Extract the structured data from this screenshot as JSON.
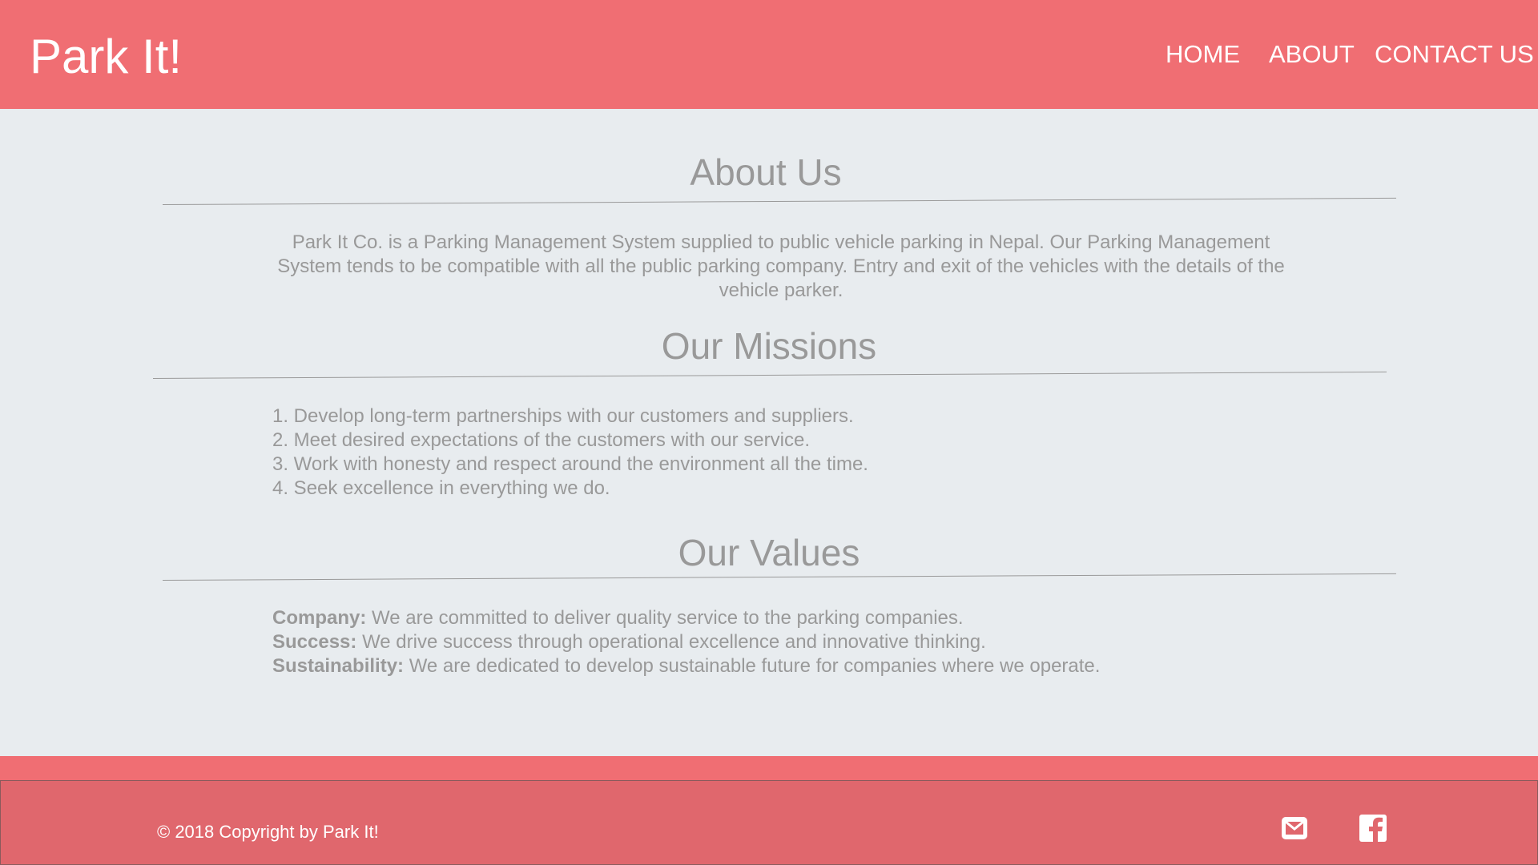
{
  "header": {
    "brand": "Park It!",
    "nav": {
      "home": "HOME",
      "about": "ABOUT",
      "contact": "CONTACT US"
    }
  },
  "about": {
    "title": "About Us",
    "text": "Park It Co. is a Parking Management System supplied to public vehicle parking in Nepal. Our Parking Management System tends to be compatible with all the public parking company. Entry and exit of the vehicles with the details of the vehicle parker."
  },
  "missions": {
    "title": "Our Missions",
    "items": [
      "1. Develop long-term partnerships with our customers and suppliers.",
      "2. Meet desired expectations of the customers with our service.",
      "3. Work with honesty and respect around the environment all the time.",
      "4. Seek excellence in everything we do."
    ]
  },
  "values": {
    "title": "Our Values",
    "items": [
      {
        "label": "Company:",
        "text": " We are committed to deliver quality service to the parking companies."
      },
      {
        "label": "Success:",
        "text": " We drive success through operational excellence and innovative thinking."
      },
      {
        "label": "Sustainability:",
        "text": " We are dedicated to develop sustainable future for companies where we operate."
      }
    ]
  },
  "footer": {
    "copyright": "© 2018 Copyright by Park It!",
    "icons": [
      "mail-icon",
      "facebook-icon"
    ]
  },
  "colors": {
    "header_bg": "#f06e73",
    "footer_bg": "#e0676d",
    "page_bg": "#e8ecef",
    "text_gray": "#999999"
  }
}
